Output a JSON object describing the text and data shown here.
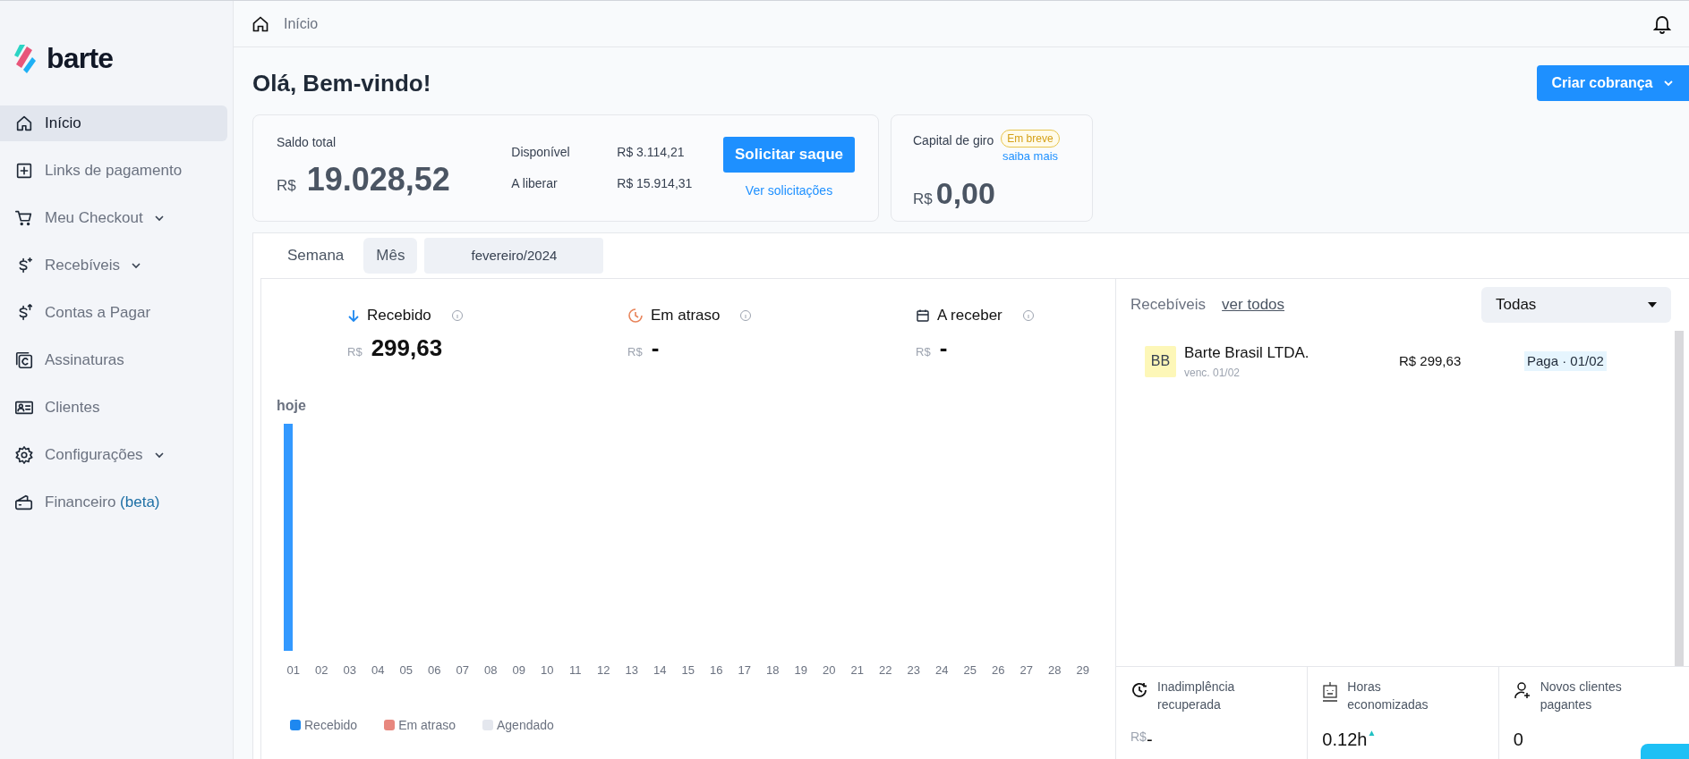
{
  "brand": {
    "name": "barte"
  },
  "sidebar": {
    "items": [
      {
        "label": "Início",
        "selected": true,
        "expandable": false
      },
      {
        "label": "Links de pagamento",
        "selected": false,
        "expandable": false
      },
      {
        "label": "Meu Checkout",
        "selected": false,
        "expandable": true
      },
      {
        "label": "Recebíveis",
        "selected": false,
        "expandable": true
      },
      {
        "label": "Contas a Pagar",
        "selected": false,
        "expandable": false
      },
      {
        "label": "Assinaturas",
        "selected": false,
        "expandable": false
      },
      {
        "label": "Clientes",
        "selected": false,
        "expandable": false
      },
      {
        "label": "Configurações",
        "selected": false,
        "expandable": true
      },
      {
        "label": "Financeiro",
        "badge": "(beta)",
        "selected": false,
        "expandable": false
      }
    ]
  },
  "breadcrumb": "Início",
  "heading": "Olá, Bem-vindo!",
  "create_button": "Criar cobrança",
  "balance": {
    "label": "Saldo total",
    "currency": "R$",
    "value": "19.028,52",
    "details": [
      {
        "label": "Disponível",
        "value": "R$ 3.114,21"
      },
      {
        "label": "A liberar",
        "value": "R$ 15.914,31"
      }
    ],
    "withdraw_button": "Solicitar saque",
    "requests_link": "Ver solicitações"
  },
  "working_capital": {
    "label": "Capital de giro",
    "badge": "Em breve",
    "link": "saiba mais",
    "currency": "R$",
    "value": "0,00"
  },
  "period_tabs": [
    {
      "label": "Semana",
      "selected": false
    },
    {
      "label": "Mês",
      "selected": true
    }
  ],
  "period_select": "fevereiro/2024",
  "summary": [
    {
      "kind": "received",
      "label": "Recebido",
      "currency": "R$",
      "value": "299,63"
    },
    {
      "kind": "overdue",
      "label": "Em atraso",
      "currency": "R$",
      "value": "-"
    },
    {
      "kind": "scheduled",
      "label": "A receber",
      "currency": "R$",
      "value": "-"
    }
  ],
  "chart": {
    "today_label": "hoje",
    "days": [
      "01",
      "02",
      "03",
      "04",
      "05",
      "06",
      "07",
      "08",
      "09",
      "10",
      "11",
      "12",
      "13",
      "14",
      "15",
      "16",
      "17",
      "18",
      "19",
      "20",
      "21",
      "22",
      "23",
      "24",
      "25",
      "26",
      "27",
      "28",
      "29"
    ],
    "legend": [
      {
        "label": "Recebido",
        "color": "#1e88f0"
      },
      {
        "label": "Em atraso",
        "color": "#e8877e"
      },
      {
        "label": "Agendado",
        "color": "#e4e7ee"
      }
    ]
  },
  "receivables": {
    "title": "Recebíveis",
    "link": "ver todos",
    "filter": "Todas",
    "rows": [
      {
        "initials": "BB",
        "name": "Barte Brasil LTDA.",
        "due": "venc. 01/02",
        "amount": "R$ 299,63",
        "status": "Paga · 01/02"
      }
    ]
  },
  "stats": [
    {
      "label": "Inadimplência recuperada",
      "currency": "R$",
      "value": "-"
    },
    {
      "label": "Horas economizadas",
      "value": "0.12h",
      "trend": "▲"
    },
    {
      "label": "Novos clientes pagantes",
      "value": "0"
    }
  ]
}
